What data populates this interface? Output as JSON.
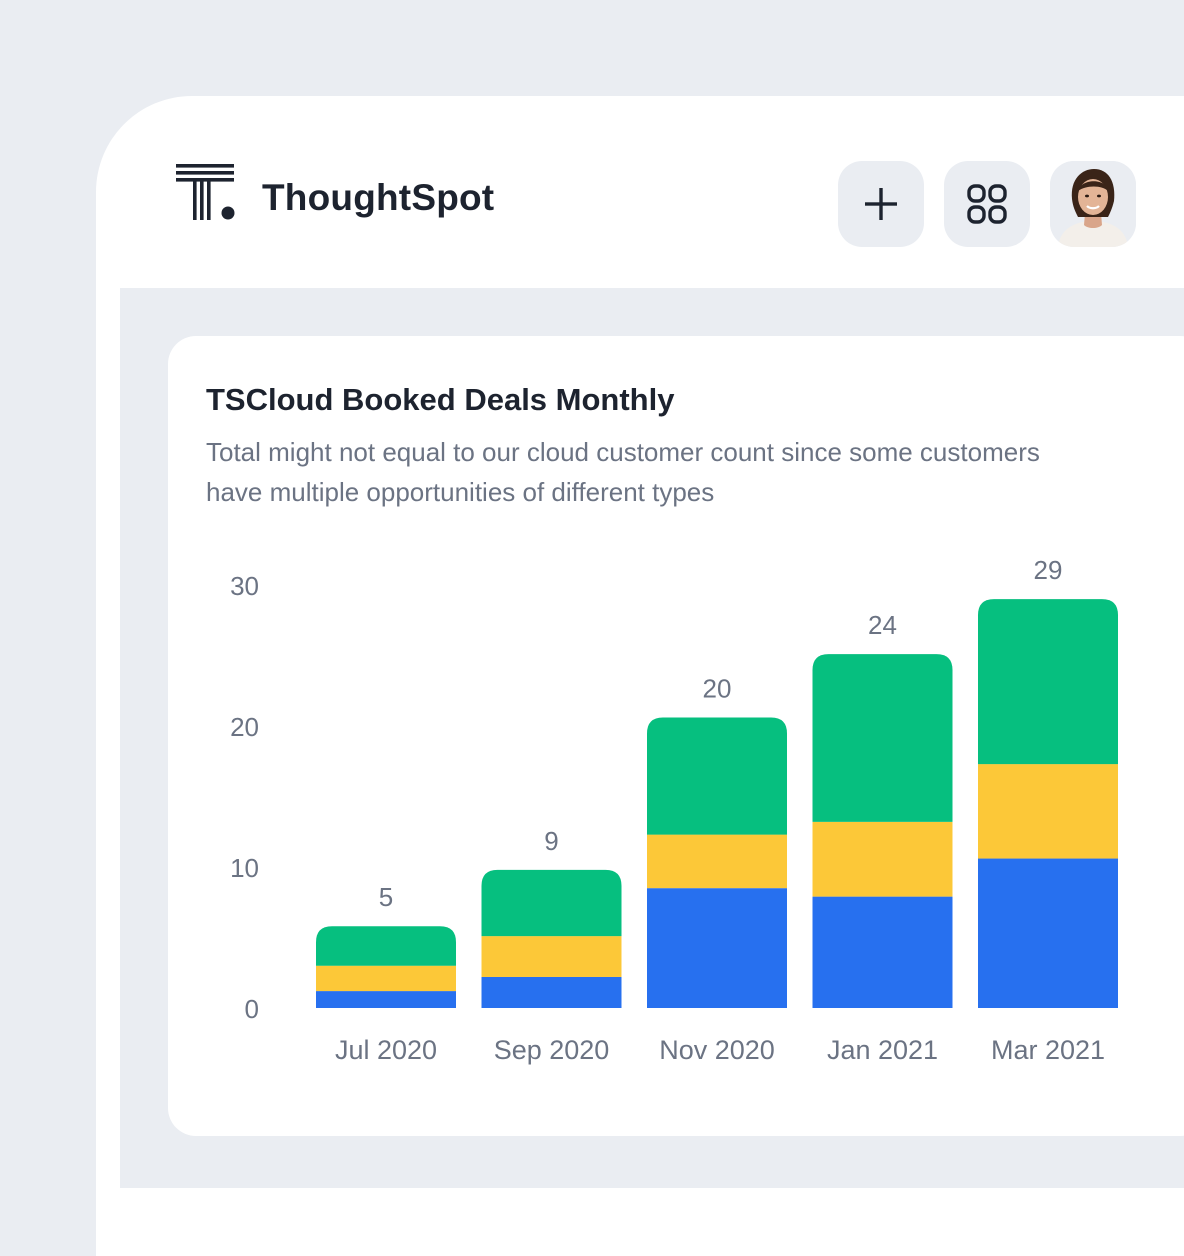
{
  "app": {
    "brand_name": "ThoughtSpot",
    "logo_icon": "thoughtspot-logo-icon",
    "buttons": [
      {
        "name": "add-button",
        "icon": "plus-icon"
      },
      {
        "name": "apps-button",
        "icon": "grid-icon"
      },
      {
        "name": "avatar-button",
        "icon": "user-avatar"
      }
    ]
  },
  "card": {
    "title": "TSCloud Booked Deals Monthly",
    "subtitle": "Total might not equal to our cloud customer count since some customers have multiple opportunities of different types"
  },
  "colors": {
    "background": "#eaedf2",
    "text_dark": "#1d232f",
    "text_muted": "#6b7383",
    "series_blue": "#2770ef",
    "series_yellow": "#fcc838",
    "series_green": "#06bf7f"
  },
  "chart_data": {
    "type": "bar",
    "stacked": true,
    "categories": [
      "Jul 2020",
      "Sep 2020",
      "Nov 2020",
      "Jan 2021",
      "Mar 2021"
    ],
    "series": [
      {
        "values": [
          1.2,
          2.2,
          8.5,
          7.9,
          10.6
        ],
        "color": "#2770ef"
      },
      {
        "values": [
          1.8,
          2.9,
          3.8,
          5.3,
          6.7
        ],
        "color": "#fcc838"
      },
      {
        "values": [
          2.8,
          4.7,
          8.3,
          11.9,
          11.7
        ],
        "color": "#06bf7f"
      }
    ],
    "totals": [
      "5",
      "9",
      "20",
      "24",
      "29"
    ],
    "y_ticks": [
      "0",
      "10",
      "20",
      "30"
    ],
    "ylim": [
      0,
      30
    ],
    "grid": false,
    "legend": "none",
    "xlabel": "",
    "ylabel": ""
  }
}
